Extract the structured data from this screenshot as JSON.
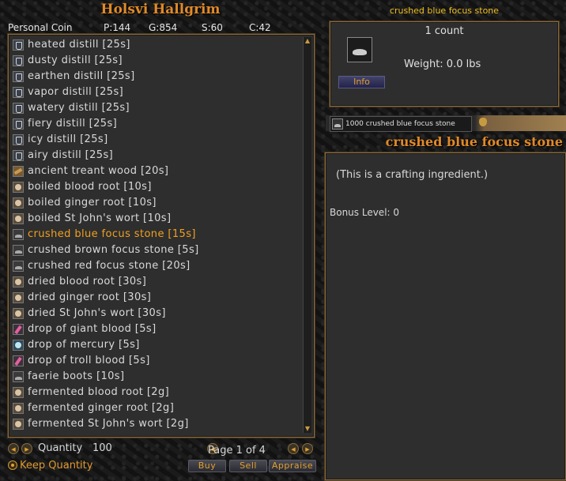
{
  "merchant": {
    "name": "Holsvi Hallgrim"
  },
  "coin": {
    "label": "Personal Coin",
    "p": "P:144",
    "g": "G:854",
    "s": "S:60",
    "c": "C:42"
  },
  "items": [
    {
      "label": "heated distill [25s]",
      "icon": "flask-icon"
    },
    {
      "label": "dusty distill [25s]",
      "icon": "flask-icon"
    },
    {
      "label": "earthen distill [25s]",
      "icon": "flask-icon"
    },
    {
      "label": "vapor distill [25s]",
      "icon": "flask-icon"
    },
    {
      "label": "watery distill [25s]",
      "icon": "flask-icon"
    },
    {
      "label": "fiery distill [25s]",
      "icon": "flask-icon"
    },
    {
      "label": "icy distill [25s]",
      "icon": "flask-icon"
    },
    {
      "label": "airy distill [25s]",
      "icon": "flask-icon"
    },
    {
      "label": "ancient treant wood [20s]",
      "icon": "wood-icon"
    },
    {
      "label": "boiled blood root [10s]",
      "icon": "root-icon"
    },
    {
      "label": "boiled ginger root [10s]",
      "icon": "root-icon"
    },
    {
      "label": "boiled St John's wort [10s]",
      "icon": "root-icon"
    },
    {
      "label": "crushed blue focus stone [15s]",
      "icon": "stone-icon",
      "selected": true
    },
    {
      "label": "crushed brown focus stone [5s]",
      "icon": "stone-icon"
    },
    {
      "label": "crushed red focus stone [20s]",
      "icon": "stone-icon"
    },
    {
      "label": "dried blood root [30s]",
      "icon": "root-icon"
    },
    {
      "label": "dried ginger root [30s]",
      "icon": "root-icon"
    },
    {
      "label": "dried St John's wort [30s]",
      "icon": "root-icon"
    },
    {
      "label": "drop of giant blood [5s]",
      "icon": "blood-icon"
    },
    {
      "label": "drop of mercury [5s]",
      "icon": "mercury-icon"
    },
    {
      "label": "drop of troll blood [5s]",
      "icon": "blood-icon"
    },
    {
      "label": "faerie boots [10s]",
      "icon": "stone-icon"
    },
    {
      "label": "fermented blood root [2g]",
      "icon": "root-icon"
    },
    {
      "label": "fermented ginger root [2g]",
      "icon": "root-icon"
    },
    {
      "label": "fermented St John's wort [2g]",
      "icon": "root-icon"
    }
  ],
  "footer": {
    "quantity_label": "Quantity",
    "quantity_value": "100",
    "page_label": "Page 1 of 4",
    "keep_quantity": "Keep Quantity",
    "buy": "Buy",
    "sell": "Sell",
    "appraise": "Appraise"
  },
  "detail": {
    "top_title": "crushed blue focus stone",
    "count": "1 count",
    "weight": "Weight: 0.0 lbs",
    "info_button": "Info",
    "tab_label": "1000 crushed blue focus stone",
    "title": "crushed blue focus stone",
    "description": "(This is a crafting ingredient.)",
    "bonus": "Bonus Level: 0"
  },
  "colors": {
    "accent": "#e08a28",
    "selected_item": "#f0a020",
    "top_title": "#f0c020"
  }
}
